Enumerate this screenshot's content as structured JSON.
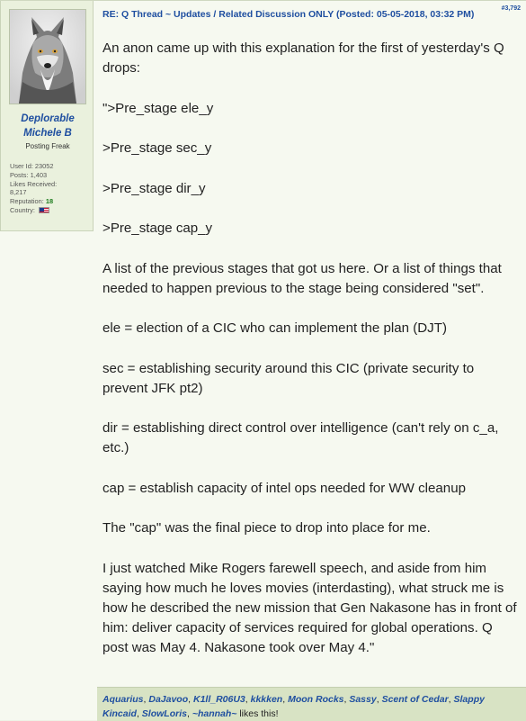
{
  "post": {
    "header": "RE: Q Thread ~ Updates / Related Discussion ONLY (Posted: 05-05-2018, 03:32 PM)",
    "post_number": "#3,792",
    "author": {
      "name_line1": "Deplorable",
      "name_line2": "Michele B",
      "title": "Posting Freak",
      "user_id": "User Id: 23052",
      "posts": "Posts: 1,403",
      "likes_label": "Likes Received:",
      "likes_value": "8,217",
      "reputation_label": "Reputation: ",
      "reputation_value": "18",
      "country_label": "Country: ",
      "avatar_icon": "wolf-avatar"
    },
    "paragraphs": [
      "An anon came up with this explanation for the first of yesterday's Q drops:",
      "\">Pre_stage ele_y",
      ">Pre_stage sec_y",
      ">Pre_stage dir_y",
      ">Pre_stage cap_y",
      "A list of the previous stages that got us here. Or a list of things that needed to happen previous to the stage being considered \"set\".",
      "ele = election of a CIC who can implement the plan (DJT)",
      "sec = establishing security around this CIC (private security to prevent JFK pt2)",
      "dir = establishing direct control over intelligence (can't rely on c_a, etc.)",
      "cap = establish capacity of intel ops needed for WW cleanup",
      "The \"cap\" was the final piece to drop into place for me.",
      "I just watched Mike Rogers farewell speech, and aside from him saying how much he loves movies (interdasting), what struck me is how he described the new mission that Gen Nakasone has in front of him: deliver capacity of services required for global operations. Q post was May 4. Nakasone took over May 4.\""
    ],
    "likes": {
      "users": [
        "Aquarius",
        "DaJavoo",
        "K1ll_R06U3",
        "kkkken",
        "Moon Rocks",
        "Sassy",
        "Scent of Cedar",
        "Slappy Kincaid",
        "SlowLoris",
        "~hannah~"
      ],
      "suffix": " likes this!"
    },
    "colors": {
      "link": "#1f4fa0",
      "reputation": "#1a7a1a",
      "likes_bar": "#d8e3c4",
      "sidebar": "#eaf1dd"
    }
  }
}
